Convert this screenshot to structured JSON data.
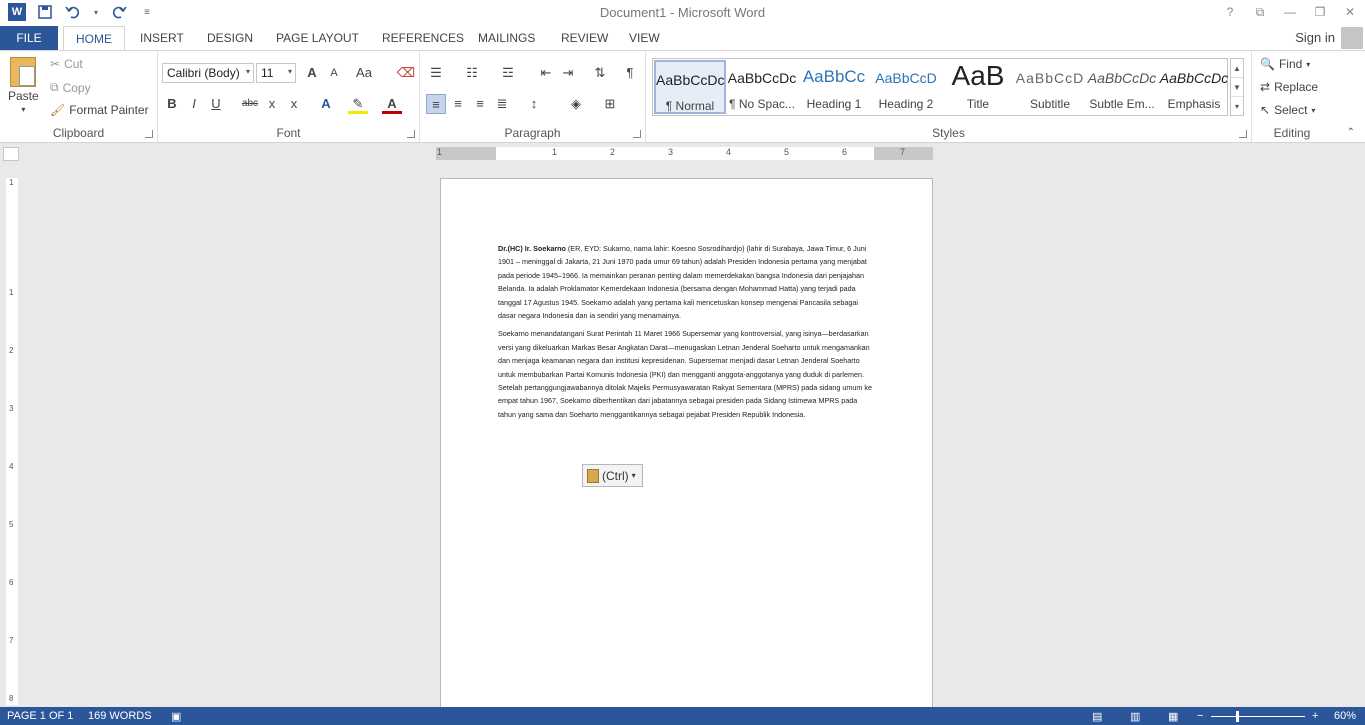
{
  "window": {
    "title": "Document1 - Microsoft Word"
  },
  "qat": {
    "word_glyph": "W",
    "save_icon": "save-icon",
    "undo_icon": "undo-icon",
    "redo_icon": "redo-icon"
  },
  "tabs": [
    {
      "label": "FILE"
    },
    {
      "label": "HOME"
    },
    {
      "label": "INSERT"
    },
    {
      "label": "DESIGN"
    },
    {
      "label": "PAGE LAYOUT"
    },
    {
      "label": "REFERENCES"
    },
    {
      "label": "MAILINGS"
    },
    {
      "label": "REVIEW"
    },
    {
      "label": "VIEW"
    }
  ],
  "user": {
    "signin": "Sign in"
  },
  "clipboard": {
    "paste": "Paste",
    "cut": "Cut",
    "copy": "Copy",
    "format_painter": "Format Painter",
    "label": "Clipboard"
  },
  "font": {
    "name": "Calibri (Body)",
    "size": "11",
    "label": "Font",
    "grow": "A",
    "shrink": "A",
    "case": "Aa",
    "bold": "B",
    "italic": "I",
    "underline": "U",
    "strike": "abc",
    "sub": "x",
    "sup": "x"
  },
  "paragraph": {
    "label": "Paragraph"
  },
  "styles": {
    "label": "Styles",
    "items": [
      {
        "sample": "AaBbCcDc",
        "name": "¶ Normal"
      },
      {
        "sample": "AaBbCcDc",
        "name": "¶ No Spac..."
      },
      {
        "sample": "AaBbCc",
        "name": "Heading 1"
      },
      {
        "sample": "AaBbCcD",
        "name": "Heading 2"
      },
      {
        "sample": "AaB",
        "name": "Title"
      },
      {
        "sample": "AaBbCcD",
        "name": "Subtitle"
      },
      {
        "sample": "AaBbCcDc",
        "name": "Subtle Em..."
      },
      {
        "sample": "AaBbCcDc",
        "name": "Emphasis"
      }
    ]
  },
  "editing": {
    "label": "Editing",
    "find": "Find",
    "replace": "Replace",
    "select": "Select"
  },
  "ruler": {
    "h_numbers": [
      "1",
      "1",
      "2",
      "3",
      "4",
      "5",
      "6",
      "7"
    ],
    "v_numbers": [
      "1",
      "1",
      "2",
      "3",
      "4",
      "5",
      "6",
      "7",
      "8"
    ]
  },
  "document": {
    "p1_bold": "Dr.(HC) Ir. Soekarno",
    "p1_rest": " (ER, EYD: Sukarno, nama lahir: Koesno Sosrodihardjo) (lahir di Surabaya, Jawa Timur, 6 Juni 1901 – meninggal di Jakarta, 21 Juni 1970 pada umur 69 tahun) adalah Presiden Indonesia pertama yang menjabat pada periode 1945–1966. Ia memainkan peranan penting dalam memerdekakan bangsa Indonesia dari penjajahan Belanda. Ia adalah Proklamator Kemerdekaan Indonesia (bersama dengan Mohammad Hatta) yang terjadi pada tanggal 17 Agustus 1945. Soekarno adalah yang pertama kali mencetuskan konsep mengenai Pancasila sebagai dasar negara Indonesia dan ia sendiri yang menamainya.",
    "p2": "Soekarno menandatangani Surat Perintah 11 Maret 1966 Supersemar yang kontroversial, yang isinya—berdasarkan versi yang dikeluarkan Markas Besar Angkatan Darat—menugaskan Letnan Jenderal Soeharto untuk mengamankan dan menjaga keamanan negara dan institusi kepresidenan. Supersemar menjadi dasar Letnan Jenderal Soeharto untuk membubarkan Partai Komunis Indonesia (PKI) dan mengganti anggota-anggotanya yang duduk di parlemen. Setelah pertanggungjawabannya ditolak Majelis Permusyawaratan Rakyat Sementara (MPRS) pada sidang umum ke empat tahun 1967, Soekarno diberhentikan dari jabatannya sebagai presiden pada Sidang Istimewa MPRS pada tahun yang sama dan Soeharto menggantikannya sebagai pejabat Presiden Republik Indonesia.",
    "paste_options": "(Ctrl)"
  },
  "status": {
    "page": "PAGE 1 OF 1",
    "words": "169 WORDS",
    "zoom": "60%"
  },
  "colors": {
    "accent": "#2b579a"
  }
}
